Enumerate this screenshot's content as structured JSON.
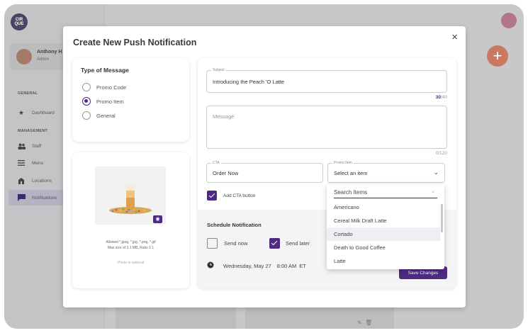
{
  "app": {
    "logo_line1": "CIR",
    "logo_line2": "QUE",
    "user_name": "Anthony H",
    "user_role": "Admin",
    "fab_label": "+"
  },
  "sidebar": {
    "general_heading": "GENERAL",
    "management_heading": "MANAGEMENT",
    "items": [
      {
        "label": "Dashboard",
        "icon": "star-icon"
      },
      {
        "label": "Staff",
        "icon": "people-icon"
      },
      {
        "label": "Menu",
        "icon": "menu-lines-icon"
      },
      {
        "label": "Locations",
        "icon": "building-icon"
      },
      {
        "label": "Notifications",
        "icon": "chat-icon",
        "active": true
      }
    ]
  },
  "modal": {
    "title": "Create New Push Notification",
    "close_label": "×",
    "type_of_message": {
      "title": "Type of Message",
      "options": [
        "Promo Code",
        "Promo Item",
        "General"
      ],
      "selected": "Promo Item"
    },
    "photo": {
      "allowed_line1": "Allowed *.jpeg, *.jpg, *.png, *.gif",
      "allowed_line2": "Max size of 3.1 MB, Ratio 1:1",
      "optional": "Photo is optional"
    },
    "subject": {
      "label": "Subject",
      "value": "Introducing the Peach 'O Latte",
      "count": "30",
      "max": "/40"
    },
    "message": {
      "placeholder": "Message",
      "counter": "0/120"
    },
    "cta": {
      "label": "CTA",
      "value": "Order Now"
    },
    "promo_item": {
      "label": "Promo Item",
      "value": "Select an item"
    },
    "add_cta": {
      "label": "Add CTA button",
      "checked": true
    },
    "schedule": {
      "title": "Schedule Notification",
      "send_now": "Send now",
      "send_now_checked": false,
      "send_later": "Send later",
      "send_later_checked": true,
      "date": "Wednesday, May 27",
      "time": "8:00 AM",
      "tz": "ET"
    },
    "save_label": "Save Changes"
  },
  "dropdown": {
    "search_placeholder": "Search Items",
    "items": [
      "Americano",
      "Cereal Milk Draft Latte",
      "Cortado",
      "Death to Good Coffee",
      "Latte"
    ],
    "hovered": "Cortado"
  },
  "colors": {
    "accent": "#4e2a83",
    "fab": "#c97962"
  }
}
